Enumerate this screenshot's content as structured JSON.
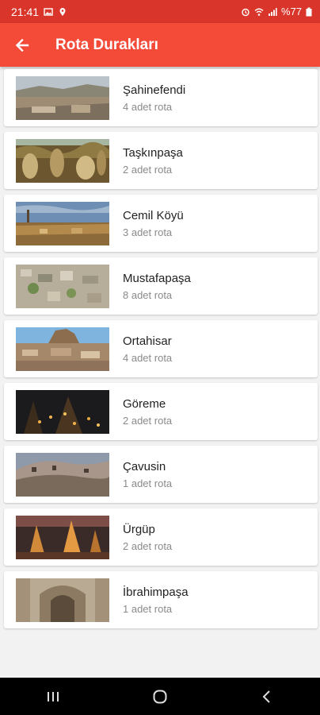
{
  "status_bar": {
    "time": "21:41",
    "battery": "%77"
  },
  "app_bar": {
    "title": "Rota Durakları",
    "back_icon": "arrow-left-icon"
  },
  "stops": [
    {
      "name": "Şahinefendi",
      "count": "4 adet rota"
    },
    {
      "name": "Taşkınpaşa",
      "count": "2 adet rota"
    },
    {
      "name": "Cemil Köyü",
      "count": "3 adet rota"
    },
    {
      "name": "Mustafapaşa",
      "count": "8 adet rota"
    },
    {
      "name": "Ortahisar",
      "count": "4 adet rota"
    },
    {
      "name": "Göreme",
      "count": "2 adet rota"
    },
    {
      "name": "Çavusin",
      "count": "1 adet rota"
    },
    {
      "name": "Ürgüp",
      "count": "2 adet rota"
    },
    {
      "name": "İbrahimpaşa",
      "count": "1 adet rota"
    }
  ],
  "colors": {
    "app_bar": "#f44a38",
    "status_bar": "#d9352a"
  }
}
